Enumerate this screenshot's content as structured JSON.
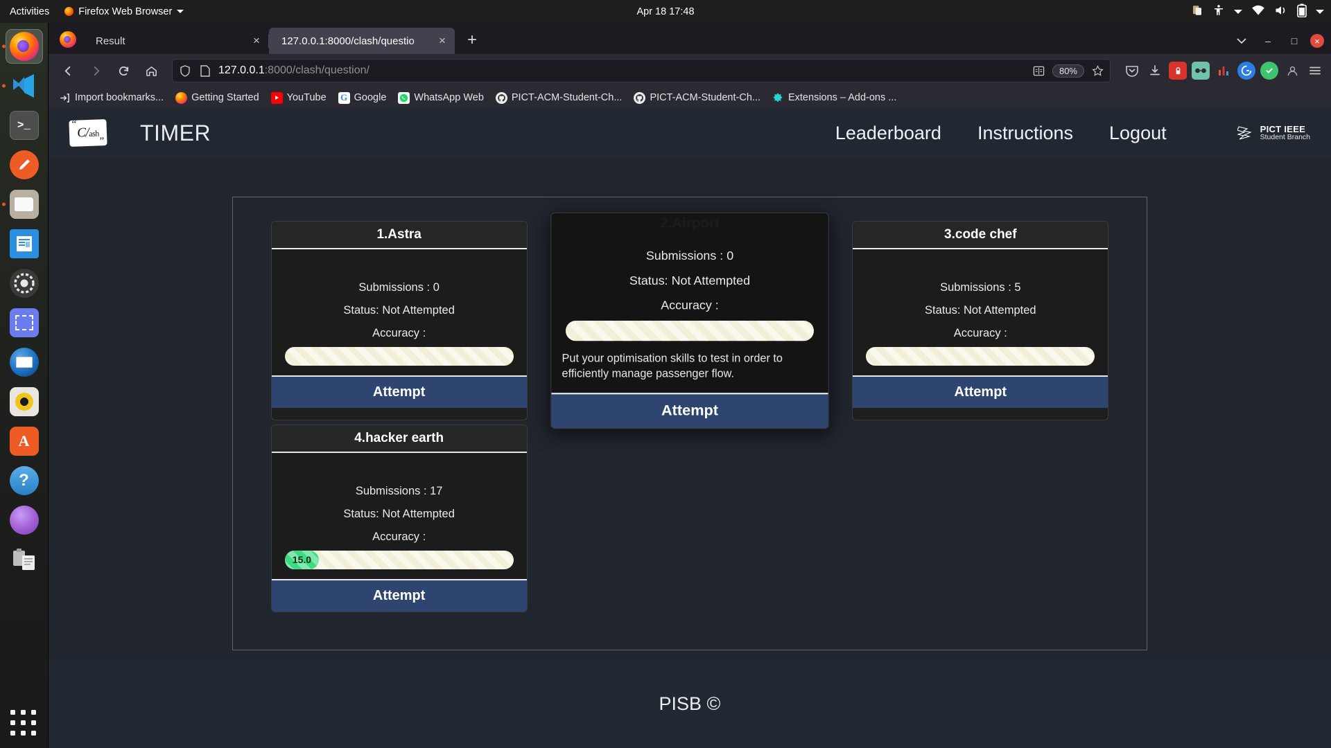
{
  "desktop": {
    "activities": "Activities",
    "app_menu": "Firefox Web Browser",
    "clock": "Apr 18  17:48",
    "tray_icons": [
      "clipboard-icon",
      "accessibility-icon",
      "wifi-icon",
      "volume-icon",
      "battery-icon"
    ]
  },
  "dock": {
    "items": [
      {
        "name": "firefox",
        "label": "Firefox"
      },
      {
        "name": "vscode",
        "label": "Visual Studio Code"
      },
      {
        "name": "terminal",
        "label": "Terminal"
      },
      {
        "name": "postman",
        "label": "Postman"
      },
      {
        "name": "files",
        "label": "Files"
      },
      {
        "name": "impress",
        "label": "LibreOffice Impress"
      },
      {
        "name": "settings",
        "label": "Settings"
      },
      {
        "name": "screenshot",
        "label": "Screenshot"
      },
      {
        "name": "thunderbird",
        "label": "Thunderbird Mail"
      },
      {
        "name": "rhythmbox",
        "label": "Rhythmbox"
      },
      {
        "name": "software",
        "label": "Ubuntu Software"
      },
      {
        "name": "help",
        "label": "Help"
      },
      {
        "name": "amazon",
        "label": "Amazon"
      },
      {
        "name": "clipboard",
        "label": "Clipboard Manager"
      },
      {
        "name": "show-apps",
        "label": "Show Applications"
      }
    ]
  },
  "browser": {
    "tabs": [
      {
        "title": "Result",
        "active": false
      },
      {
        "title": "127.0.0.1:8000/clash/questio",
        "active": true
      }
    ],
    "new_tab_label": "+",
    "close_glyph": "×",
    "url_host": "127.0.0.1",
    "url_path": ":8000/clash/question/",
    "zoom_level": "80%",
    "window_controls": {
      "minimize": "–",
      "maximize": "□",
      "close": "×"
    },
    "bookmarks": [
      {
        "label": "Import bookmarks...",
        "icon": "import-icon"
      },
      {
        "label": "Getting Started",
        "icon": "firefox-icon"
      },
      {
        "label": "YouTube",
        "icon": "youtube-icon"
      },
      {
        "label": "Google",
        "icon": "google-icon"
      },
      {
        "label": "WhatsApp Web",
        "icon": "whatsapp-icon"
      },
      {
        "label": "PICT-ACM-Student-Ch...",
        "icon": "github-icon"
      },
      {
        "label": "PICT-ACM-Student-Ch...",
        "icon": "github-icon"
      },
      {
        "label": "Extensions – Add-ons ...",
        "icon": "addons-icon"
      }
    ]
  },
  "site": {
    "logo_text": "C/ash",
    "brand_title": "TIMER",
    "nav_links": [
      "Leaderboard",
      "Instructions",
      "Logout"
    ],
    "org_logo": {
      "line1": "PICT IEEE",
      "line2": "Student Branch"
    },
    "footer": "PISB ©"
  },
  "questions": [
    {
      "title": "1.Astra",
      "submissions_label": "Submissions : 0",
      "status_label": "Status: Not Attempted",
      "accuracy_label": "Accuracy :",
      "accuracy_value": "",
      "accuracy_percent": 0,
      "description": "",
      "action": "Attempt",
      "raised": false
    },
    {
      "title": "2.Airport",
      "submissions_label": "Submissions : 0",
      "status_label": "Status: Not Attempted",
      "accuracy_label": "Accuracy :",
      "accuracy_value": "",
      "accuracy_percent": 0,
      "description": "Put your optimisation skills to test in order to efficiently manage passenger flow.",
      "action": "Attempt",
      "raised": true
    },
    {
      "title": "3.code chef",
      "submissions_label": "Submissions : 5",
      "status_label": "Status: Not Attempted",
      "accuracy_label": "Accuracy :",
      "accuracy_value": "",
      "accuracy_percent": 0,
      "description": "",
      "action": "Attempt",
      "raised": false
    },
    {
      "title": "4.hacker earth",
      "submissions_label": "Submissions : 17",
      "status_label": "Status: Not Attempted",
      "accuracy_label": "Accuracy :",
      "accuracy_value": "15.0",
      "accuracy_percent": 15,
      "description": "",
      "action": "Attempt",
      "raised": false
    }
  ],
  "colors": {
    "page_bg": "#21252e",
    "nav_bg": "#222831",
    "card_bg": "#1e1e1e",
    "attempt_btn": "#2e4570",
    "progress_track": "#f2efd8",
    "progress_fill": "#3ddc84",
    "ubuntu_orange": "#e95420"
  }
}
